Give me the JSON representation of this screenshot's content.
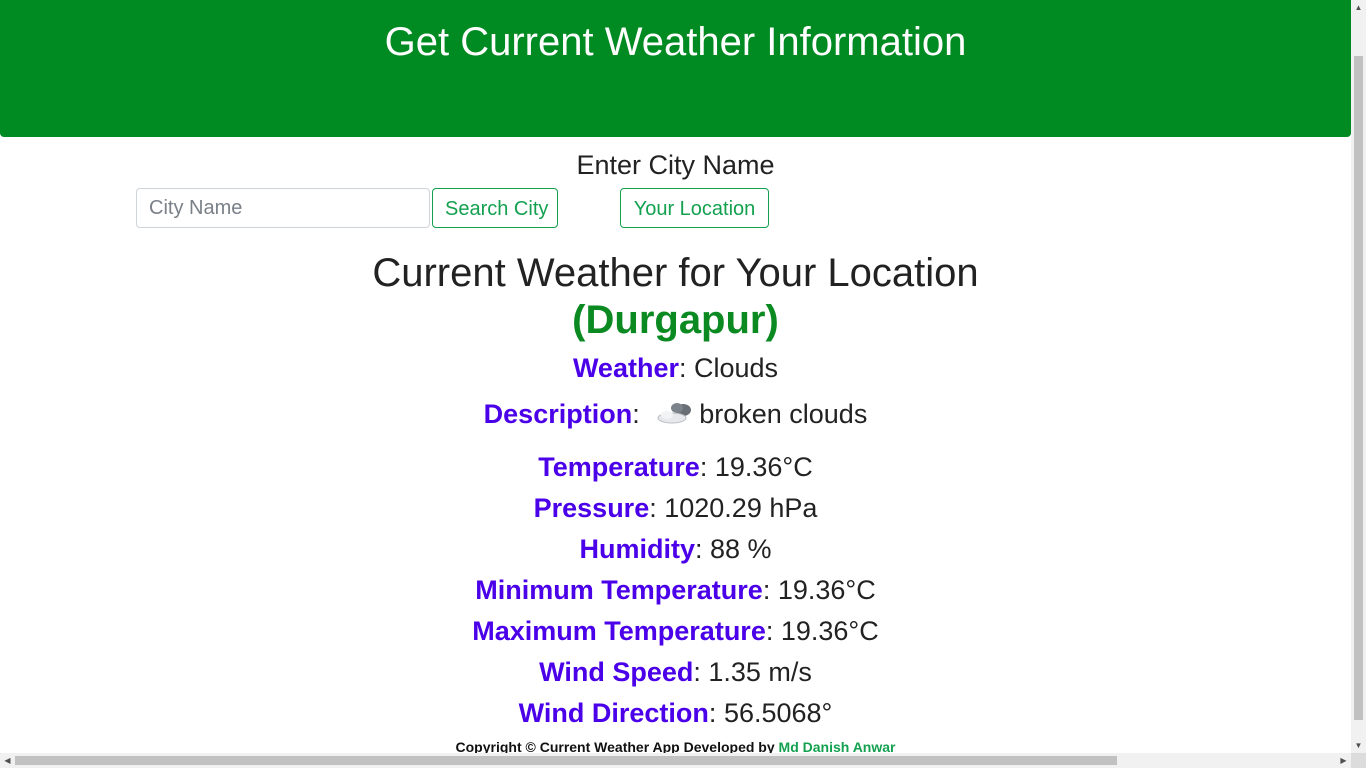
{
  "header": {
    "title": "Get Current Weather Information"
  },
  "search": {
    "heading": "Enter City Name",
    "placeholder": "City Name",
    "value": "",
    "search_button": "Search City",
    "location_button": "Your Location"
  },
  "weather": {
    "title": "Current Weather for Your Location",
    "city": "(Durgapur)",
    "rows": [
      {
        "label": "Weather",
        "sep": ": ",
        "value": "Clouds"
      },
      {
        "label": "Description",
        "sep": ": ",
        "value": "broken clouds",
        "icon": "broken-clouds-icon"
      },
      {
        "label": "Temperature",
        "sep": ": ",
        "value": "19.36°C"
      },
      {
        "label": "Pressure",
        "sep": ": ",
        "value": "1020.29 hPa"
      },
      {
        "label": "Humidity",
        "sep": ": ",
        "value": "88 %"
      },
      {
        "label": "Minimum Temperature",
        "sep": ": ",
        "value": "19.36°C"
      },
      {
        "label": "Maximum Temperature",
        "sep": ": ",
        "value": "19.36°C"
      },
      {
        "label": "Wind Speed",
        "sep": ": ",
        "value": "1.35 m/s"
      },
      {
        "label": "Wind Direction",
        "sep": ": ",
        "value": "56.5068°"
      }
    ]
  },
  "footer": {
    "text": "Copyright © Current Weather App Developed by ",
    "author": "Md Danish Anwar"
  },
  "colors": {
    "header_bg": "#008a22",
    "accent_green": "#13a150",
    "label_purple": "#4a00e8",
    "city_green": "#0b8a22"
  }
}
